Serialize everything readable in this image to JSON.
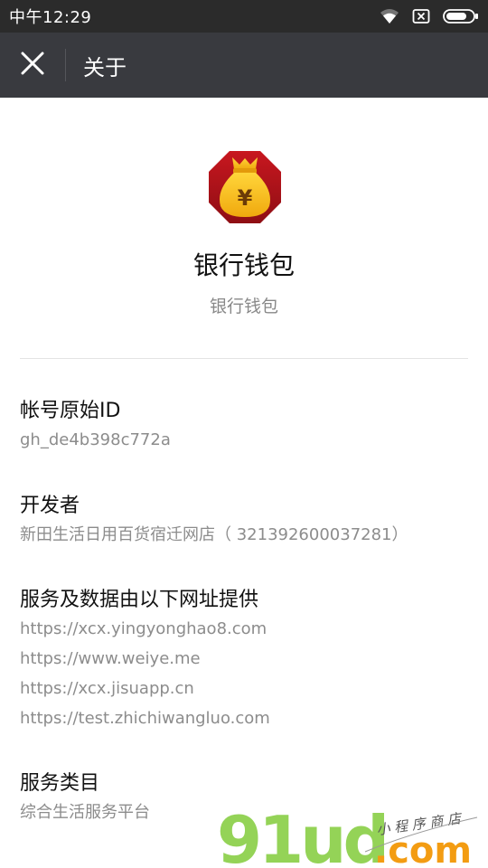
{
  "status_bar": {
    "time": "中午12:29",
    "icons": [
      "wifi-icon",
      "sim-icon",
      "battery-icon"
    ]
  },
  "app_bar": {
    "title": "关于",
    "close_icon": "close-icon"
  },
  "profile": {
    "name": "银行钱包",
    "description": "银行钱包",
    "logo_symbol": "¥",
    "logo_colors": {
      "background": "#b3121b",
      "bag": "#f5c518"
    }
  },
  "sections": {
    "account_id": {
      "label": "帐号原始ID",
      "value": "gh_de4b398c772a"
    },
    "developer": {
      "label": "开发者",
      "value": "新田生活日用百货宿迁网店（ 321392600037281）"
    },
    "service_urls": {
      "label": "服务及数据由以下网址提供",
      "urls": [
        "https://xcx.yingyonghao8.com",
        "https://www.weiye.me",
        "https://xcx.jisuapp.cn",
        "https://test.zhichiwangluo.com"
      ]
    },
    "category": {
      "label": "服务类目",
      "value": "综合生活服务平台"
    }
  },
  "watermark": {
    "brand": "91ud",
    "domain": ".com",
    "tagline": "小 程 序 商 店"
  },
  "colors": {
    "status_bar": "#2b2b2b",
    "app_bar": "#393a3f",
    "watermark_green": "#8fd14f",
    "watermark_orange": "#f39c12"
  }
}
